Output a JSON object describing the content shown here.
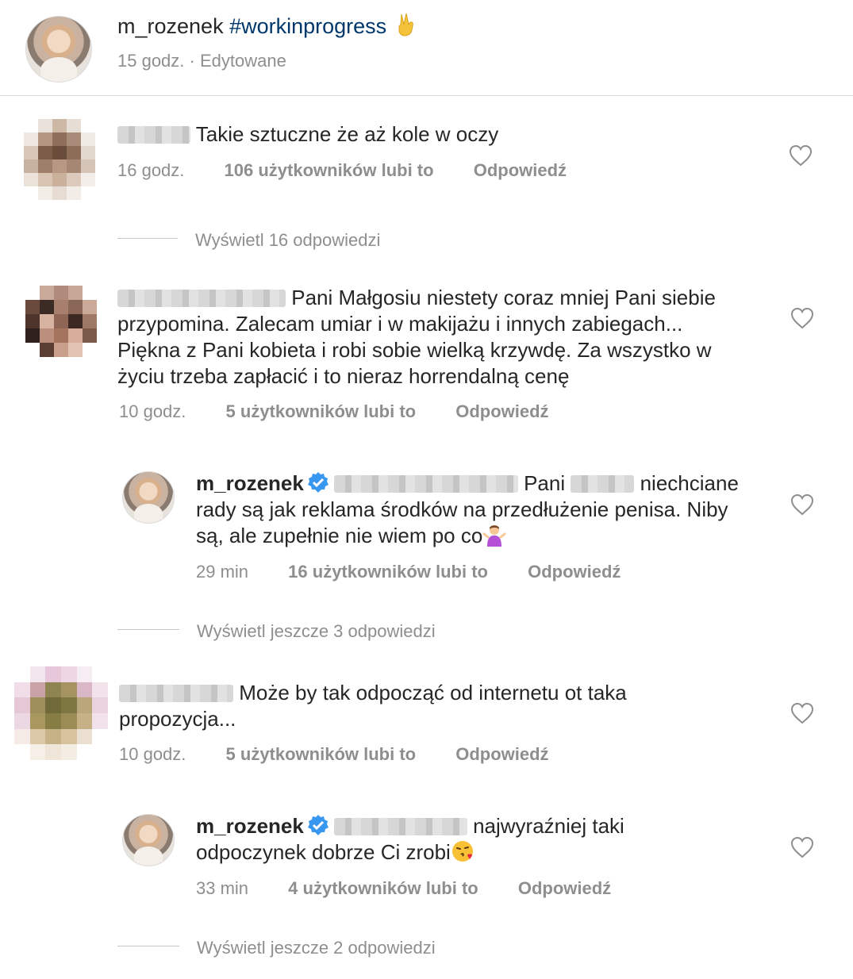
{
  "post": {
    "author": "m_rozenek",
    "caption": "#workinprogress",
    "caption_icon": "victory-hand-icon",
    "time": "15 godz.",
    "edited": "Edytowane",
    "separator": "·"
  },
  "comments": [
    {
      "text": "Takie sztuczne że aż kole w oczy",
      "time": "16 godz.",
      "likes": "106 użytkowników lubi to",
      "reply": "Odpowiedź",
      "view_replies": "Wyświetl 16 odpowiedzi"
    },
    {
      "text_line1": "Pani Małgosiu niestety coraz mniej Pani siebie",
      "text_line2": "przypomina. Zalecam umiar i w makijażu i innych zabiegach...",
      "text_line3": "Piękna z Pani kobieta i robi sobie wielką krzywdę. Za wszystko w",
      "text_line4": "życiu trzeba zapłacić i to nieraz horrendalną cenę",
      "time": "10 godz.",
      "likes": "5 użytkowników lubi to",
      "reply": "Odpowiedź",
      "reply_item": {
        "author": "m_rozenek",
        "text_pre": "Pani",
        "text_line1_end": "niechciane",
        "text_line2": "rady są jak reklama środków na przedłużenie penisa. Niby",
        "text_line3": "są, ale zupełnie nie wiem po co",
        "emoji": "person-shrugging-icon",
        "time": "29 min",
        "likes": "16 użytkowników lubi to",
        "reply": "Odpowiedź"
      },
      "view_replies": "Wyświetl jeszcze 3 odpowiedzi"
    },
    {
      "text_line1": "Może by tak odpocząć od internetu ot taka",
      "text_line2": "propozycja...",
      "time": "10 godz.",
      "likes": "5 użytkowników lubi to",
      "reply": "Odpowiedź",
      "reply_item": {
        "author": "m_rozenek",
        "text_line1_end": "najwyraźniej taki",
        "text_line2": "odpoczynek dobrze Ci zrobi",
        "emoji": "face-blowing-kiss-icon",
        "time": "33 min",
        "likes": "4 użytkowników lubi to",
        "reply": "Odpowiedź"
      },
      "view_replies": "Wyświetl jeszcze 2 odpowiedzi"
    }
  ],
  "colors": {
    "text": "#262626",
    "meta": "#8e8e8e",
    "hashtag": "#00376b",
    "verified": "#3897f0",
    "divider": "#dbdbdb"
  }
}
